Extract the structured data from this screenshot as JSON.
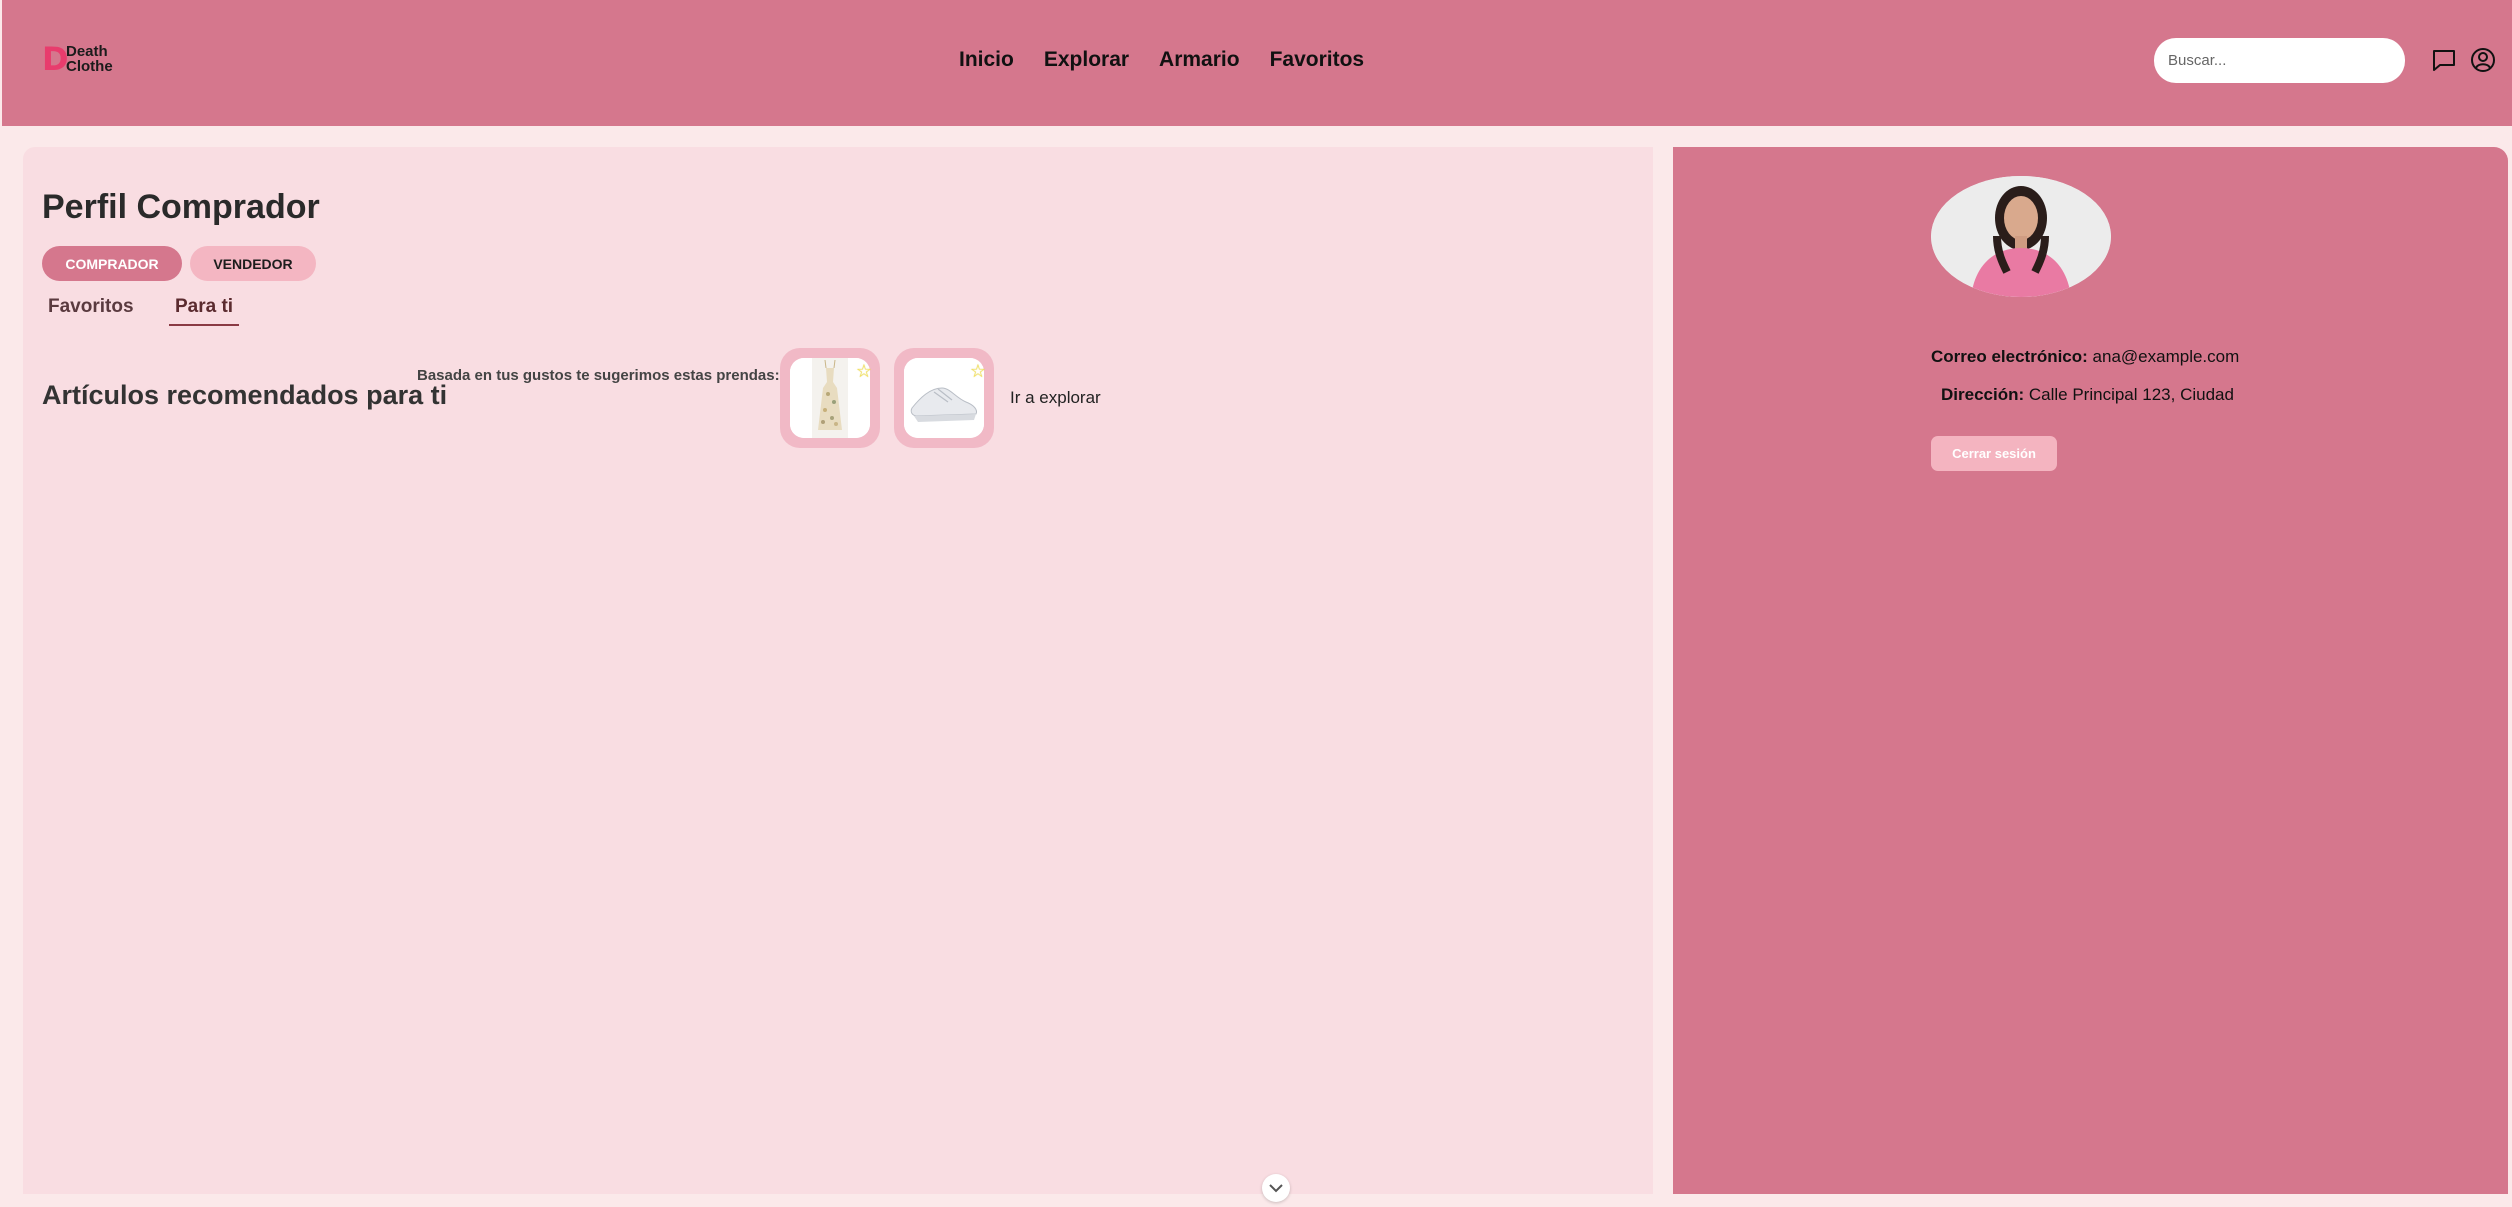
{
  "brand": {
    "mark": "D",
    "line1": "Death",
    "line2": "Clothe"
  },
  "nav": {
    "items": [
      {
        "label": "Inicio"
      },
      {
        "label": "Explorar"
      },
      {
        "label": "Armario"
      },
      {
        "label": "Favoritos"
      }
    ]
  },
  "search": {
    "placeholder": "Buscar...",
    "value": ""
  },
  "header_icons": [
    "chat-icon",
    "user-icon"
  ],
  "profile": {
    "title": "Perfil Comprador",
    "roles": [
      "COMPRADOR",
      "VENDEDOR"
    ],
    "active_role": "COMPRADOR",
    "tabs": [
      "Favoritos",
      "Para ti"
    ],
    "active_tab": "Para ti"
  },
  "recommendations": {
    "title": "Artículos recomendados para ti",
    "subtitle": "Basada en tus gustos te sugerimos estas prendas:",
    "items": [
      {
        "name": "floral-dress",
        "star": "☆"
      },
      {
        "name": "white-sneaker",
        "star": "☆"
      }
    ],
    "explore_link": "Ir a explorar"
  },
  "account": {
    "email_label": "Correo electrónico:",
    "email_value": "ana@example.com",
    "address_label": "Dirección:",
    "address_value": "Calle Principal 123, Ciudad",
    "logout_label": "Cerrar sesión"
  },
  "colors": {
    "header_bg": "#d5778d",
    "panel_left_bg": "#f9dde2",
    "panel_right_bg": "#d5778d",
    "accent": "#e83c6d",
    "active_role_bg": "#d5778d",
    "inactive_role_bg": "#f4b6c2"
  }
}
